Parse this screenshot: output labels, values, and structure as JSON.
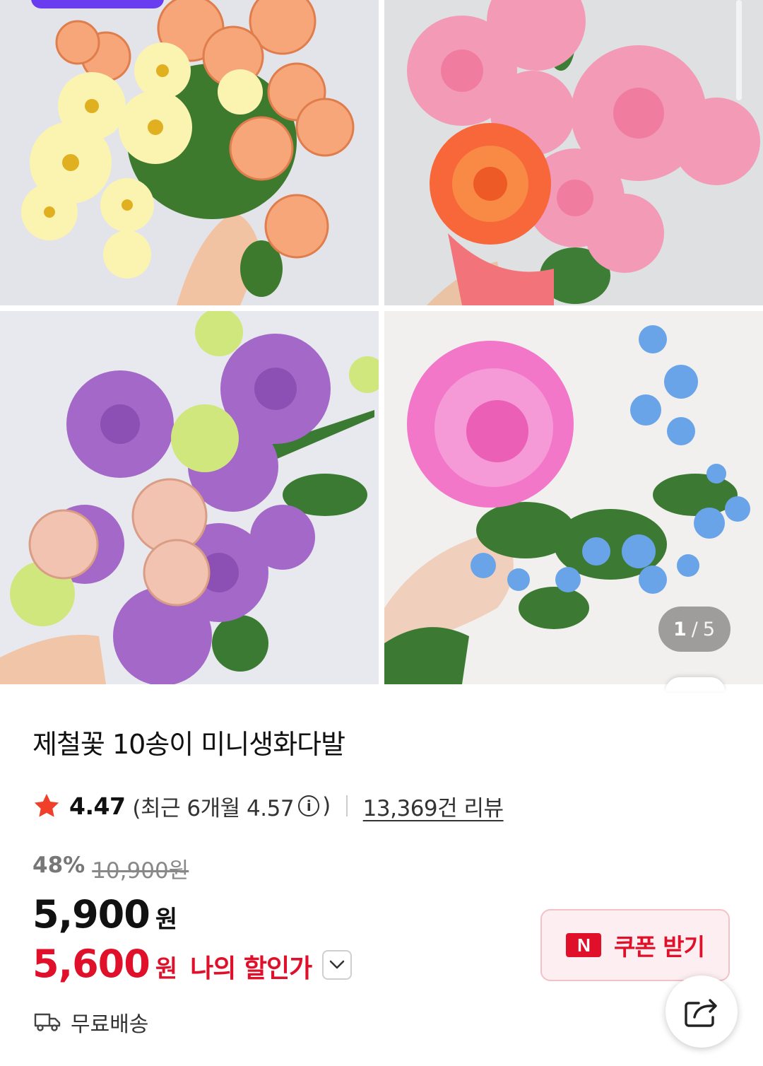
{
  "gallery": {
    "current_index": "1",
    "separator": "/",
    "total": "5",
    "images": [
      {
        "name": "orange-rose-daisy-bouquet"
      },
      {
        "name": "pink-lisianthus-orange-rose-bouquet"
      },
      {
        "name": "purple-lisianthus-peach-rose-bouquet"
      },
      {
        "name": "pink-peony-blue-star-flower-bouquet"
      }
    ]
  },
  "product": {
    "title": "제철꽃 10송이 미니생화다발",
    "rating": "4.47",
    "recent_prefix": "(최근 6개월 4.57",
    "info_glyph": "i",
    "recent_suffix": ")",
    "review_count": "13,369건 리뷰",
    "discount_rate": "48%",
    "original_price": "10,900원",
    "price": "5,900",
    "price_unit": "원",
    "my_price": "5,600",
    "my_price_unit": "원",
    "my_price_label": "나의 할인가",
    "coupon_badge": "N",
    "coupon_label": "쿠폰 받기",
    "shipping": "무료배송"
  },
  "colors": {
    "accent_red": "#e0102a",
    "top_pill": "#6a3cf0",
    "star": "#f0402a"
  },
  "icons": [
    "star-icon",
    "info-icon",
    "chevron-down-icon",
    "truck-icon",
    "share-icon"
  ]
}
